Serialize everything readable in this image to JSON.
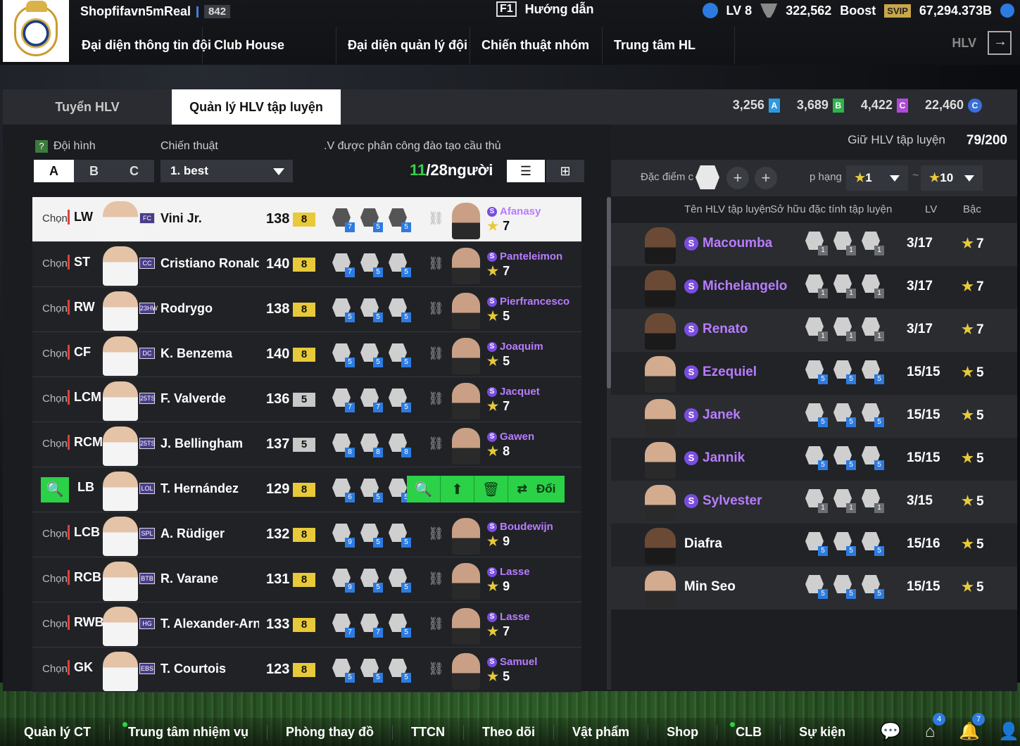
{
  "topbar": {
    "username": "Shopfifavn5mReal",
    "user_level": "842",
    "guide_key": "F1",
    "guide_label": "Hướng dẫn",
    "lv": "LV 8",
    "points": "322,562",
    "boost": "Boost",
    "svip": "SVIP",
    "coins": "67,294.373B",
    "hlv": "HLV",
    "nav": [
      "Đại diện thông tin đội",
      "Club House",
      "Đại diện quản lý đội",
      "Chiến thuật nhóm",
      "Trung tâm HL"
    ]
  },
  "tabs": {
    "recruit": "Tuyển HLV",
    "manage": "Quản lý HLV tập luyện"
  },
  "resources": [
    {
      "value": "3,256",
      "tag": "A",
      "color": "#2d9be0"
    },
    {
      "value": "3,689",
      "tag": "B",
      "color": "#2fb34a"
    },
    {
      "value": "4,422",
      "tag": "C",
      "color": "#b04ad6"
    },
    {
      "value": "22,460",
      "tag": "C",
      "color": "#3a6fd8"
    }
  ],
  "left": {
    "formation_label": "Đội hình",
    "formations": [
      "A",
      "B",
      "C"
    ],
    "tactic_label": "Chiến thuật",
    "tactic_value": "1. best",
    "assigned_label": ".V được phân công đào tạo cầu thủ",
    "assigned_count": "11",
    "assigned_total": "/28người",
    "rows": [
      {
        "chon": "Chọn",
        "pos": "LW",
        "season": "FC",
        "name": "Vini Jr.",
        "ovr": "138",
        "plus": "8",
        "skills": [
          "7",
          "5",
          "5"
        ],
        "coach": "Afanasy",
        "coach_rank": "7"
      },
      {
        "chon": "Chọn",
        "pos": "ST",
        "season": "CC",
        "name": "Cristiano Ronaldo",
        "ovr": "140",
        "plus": "8",
        "skills": [
          "7",
          "5",
          "5"
        ],
        "coach": "Panteleimon",
        "coach_rank": "7"
      },
      {
        "chon": "Chọn",
        "pos": "RW",
        "season": "23HW",
        "name": "Rodrygo",
        "ovr": "138",
        "plus": "8",
        "skills": [
          "5",
          "5",
          "5"
        ],
        "coach": "Pierfrancesco",
        "coach_rank": "5"
      },
      {
        "chon": "Chọn",
        "pos": "CF",
        "season": "DC",
        "name": "K. Benzema",
        "ovr": "140",
        "plus": "8",
        "skills": [
          "5",
          "5",
          "5"
        ],
        "coach": "Joaquim",
        "coach_rank": "5"
      },
      {
        "chon": "Chọn",
        "pos": "LCM",
        "season": "25TS",
        "name": "F. Valverde",
        "ovr": "136",
        "plus": "5",
        "skills": [
          "7",
          "7",
          "5"
        ],
        "coach": "Jacquet",
        "coach_rank": "7"
      },
      {
        "chon": "Chọn",
        "pos": "RCM",
        "season": "25TS",
        "name": "J. Bellingham",
        "ovr": "137",
        "plus": "5",
        "skills": [
          "8",
          "8",
          "8"
        ],
        "coach": "Gawen",
        "coach_rank": "8"
      },
      {
        "chon": "",
        "pos": "LB",
        "season": "LOL",
        "name": "T. Hernández",
        "ovr": "129",
        "plus": "8",
        "skills": [
          "6",
          "5",
          "5"
        ],
        "coach": "",
        "coach_rank": ""
      },
      {
        "chon": "Chọn",
        "pos": "LCB",
        "season": "SPL",
        "name": "A. Rüdiger",
        "ovr": "132",
        "plus": "8",
        "skills": [
          "9",
          "5",
          "5"
        ],
        "coach": "Boudewijn",
        "coach_rank": "9"
      },
      {
        "chon": "Chọn",
        "pos": "RCB",
        "season": "BTB",
        "name": "R. Varane",
        "ovr": "131",
        "plus": "8",
        "skills": [
          "9",
          "5",
          "5"
        ],
        "coach": "Lasse",
        "coach_rank": "9"
      },
      {
        "chon": "Chọn",
        "pos": "RWB",
        "season": "HG",
        "name": "T. Alexander-Arnold",
        "ovr": "133",
        "plus": "8",
        "skills": [
          "7",
          "7",
          "5"
        ],
        "coach": "Lasse",
        "coach_rank": "7"
      },
      {
        "chon": "Chọn",
        "pos": "GK",
        "season": "EBS",
        "name": "T. Courtois",
        "ovr": "123",
        "plus": "8",
        "skills": [
          "5",
          "5",
          "5"
        ],
        "coach": "Samuel",
        "coach_rank": "5"
      }
    ],
    "swap_label": "Đổi"
  },
  "right": {
    "retain_label": "Giữ HLV tập luyện",
    "retain_value": "79/200",
    "trait_label": "Đặc điểm c",
    "rank_label": "p hạng",
    "rank_from": "1",
    "rank_to": "10",
    "tilde": "~",
    "head_name": "Tên HLV tập luyện",
    "head_traits": "Sở hữu đặc tính tập luyện",
    "head_lv": "LV",
    "head_rank": "Bậc",
    "coaches": [
      {
        "name": "Macoumba",
        "special": true,
        "traits": [
          "1",
          "1",
          "1"
        ],
        "trait_gray": true,
        "lv": "3/17",
        "rank": "7"
      },
      {
        "name": "Michelangelo",
        "special": true,
        "traits": [
          "1",
          "1",
          "1"
        ],
        "trait_gray": true,
        "lv": "3/17",
        "rank": "7"
      },
      {
        "name": "Renato",
        "special": true,
        "traits": [
          "1",
          "1",
          "1"
        ],
        "trait_gray": true,
        "lv": "3/17",
        "rank": "7"
      },
      {
        "name": "Ezequiel",
        "special": true,
        "traits": [
          "5",
          "5",
          "5"
        ],
        "trait_gray": false,
        "lv": "15/15",
        "rank": "5"
      },
      {
        "name": "Janek",
        "special": true,
        "traits": [
          "5",
          "5",
          "5"
        ],
        "trait_gray": false,
        "lv": "15/15",
        "rank": "5"
      },
      {
        "name": "Jannik",
        "special": true,
        "traits": [
          "5",
          "5",
          "5"
        ],
        "trait_gray": false,
        "lv": "15/15",
        "rank": "5"
      },
      {
        "name": "Sylvester",
        "special": true,
        "traits": [
          "1",
          "1",
          "1"
        ],
        "trait_gray": true,
        "lv": "3/15",
        "rank": "5"
      },
      {
        "name": "Diafra",
        "special": false,
        "traits": [
          "5",
          "5",
          "5"
        ],
        "trait_gray": false,
        "lv": "15/16",
        "rank": "5"
      },
      {
        "name": "Min Seo",
        "special": false,
        "traits": [
          "5",
          "5",
          "5"
        ],
        "trait_gray": false,
        "lv": "15/15",
        "rank": "5"
      }
    ]
  },
  "bottomnav": {
    "items": [
      "Quản lý CT",
      "Trung tâm nhiệm vụ",
      "Phòng thay đồ",
      "TTCN",
      "Theo dõi",
      "Vật phẩm",
      "Shop",
      "CLB",
      "Sự kiện"
    ],
    "badge_home": "4",
    "badge_bell": "7"
  }
}
